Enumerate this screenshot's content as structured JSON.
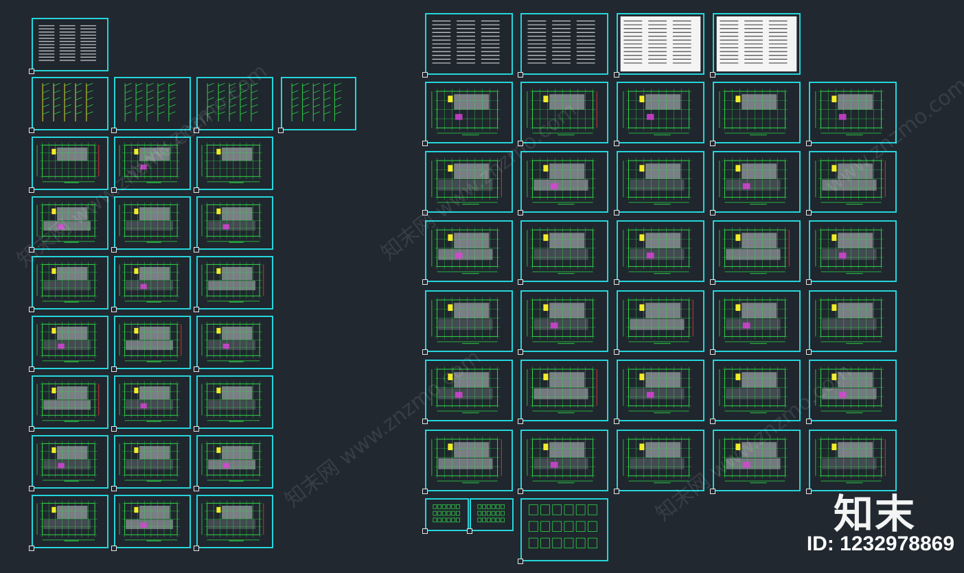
{
  "colors": {
    "background": "#212830",
    "sheet_border": "#25d6dc",
    "plan_green": "#2fe04a",
    "plan_gray": "#8a8f94",
    "plan_yellow": "#f2ec2a",
    "plan_magenta": "#e040e0",
    "plan_red": "#e83030",
    "paper_white": "#f4f4f4"
  },
  "left_group": {
    "rows": [
      {
        "kind": "text",
        "count": 1
      },
      {
        "kind": "diagram",
        "count": 4
      },
      {
        "kind": "plan-small",
        "count": 3
      },
      {
        "kind": "plan",
        "count": 3
      },
      {
        "kind": "plan",
        "count": 3
      },
      {
        "kind": "plan",
        "count": 3
      },
      {
        "kind": "plan",
        "count": 3
      },
      {
        "kind": "plan",
        "count": 3
      },
      {
        "kind": "plan",
        "count": 3
      }
    ]
  },
  "right_group": {
    "rows": [
      {
        "kind": "text-mixed",
        "count": 4
      },
      {
        "kind": "plan-small",
        "count": 5
      },
      {
        "kind": "plan",
        "count": 5
      },
      {
        "kind": "plan",
        "count": 5
      },
      {
        "kind": "plan",
        "count": 5
      },
      {
        "kind": "plan",
        "count": 5
      },
      {
        "kind": "plan",
        "count": 5
      },
      {
        "kind": "details",
        "count": 2
      }
    ]
  },
  "branding": {
    "logo_text": "知末",
    "id_text": "ID: 1232978869"
  },
  "watermarks": [
    "知末网 www.znzmo.com",
    "知末网 www.znzmo.com",
    "知末网 www.znzmo.com",
    "知末网 www.znzmo.com",
    "www.znzmo.com",
    "www.znzmo.com"
  ]
}
